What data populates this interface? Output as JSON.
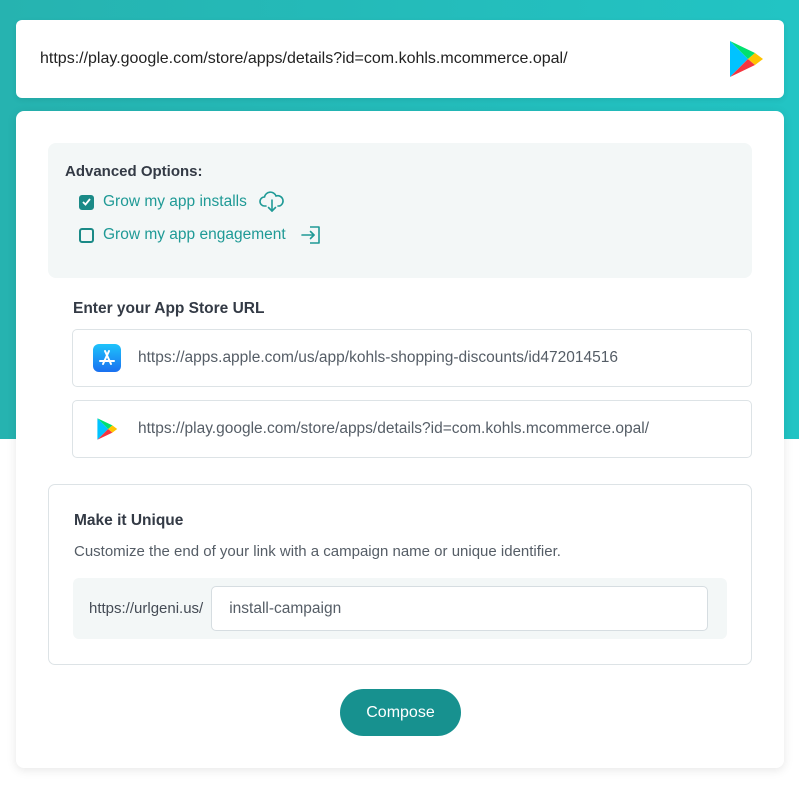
{
  "top_url_bar": {
    "url": "https://play.google.com/store/apps/details?id=com.kohls.mcommerce.opal/",
    "icon": "google-play-icon"
  },
  "advanced_options": {
    "title": "Advanced Options:",
    "options": [
      {
        "label": "Grow my app installs",
        "checked": true,
        "icon": "cloud-download-icon"
      },
      {
        "label": "Grow my app engagement",
        "checked": false,
        "icon": "sign-in-icon"
      }
    ]
  },
  "app_store": {
    "title": "Enter your App Store URL",
    "apple_url": "https://apps.apple.com/us/app/kohls-shopping-discounts/id472014516",
    "google_url": "https://play.google.com/store/apps/details?id=com.kohls.mcommerce.opal/",
    "apple_icon": "app-store-icon",
    "google_icon": "google-play-icon"
  },
  "unique": {
    "title": "Make it Unique",
    "description": "Customize the end of your link with a campaign name or unique identifier.",
    "prefix": "https://urlgeni.us/",
    "value": "install-campaign"
  },
  "compose_label": "Compose",
  "colors": {
    "accent": "#17918f",
    "header_bg": "#22c4c4"
  }
}
